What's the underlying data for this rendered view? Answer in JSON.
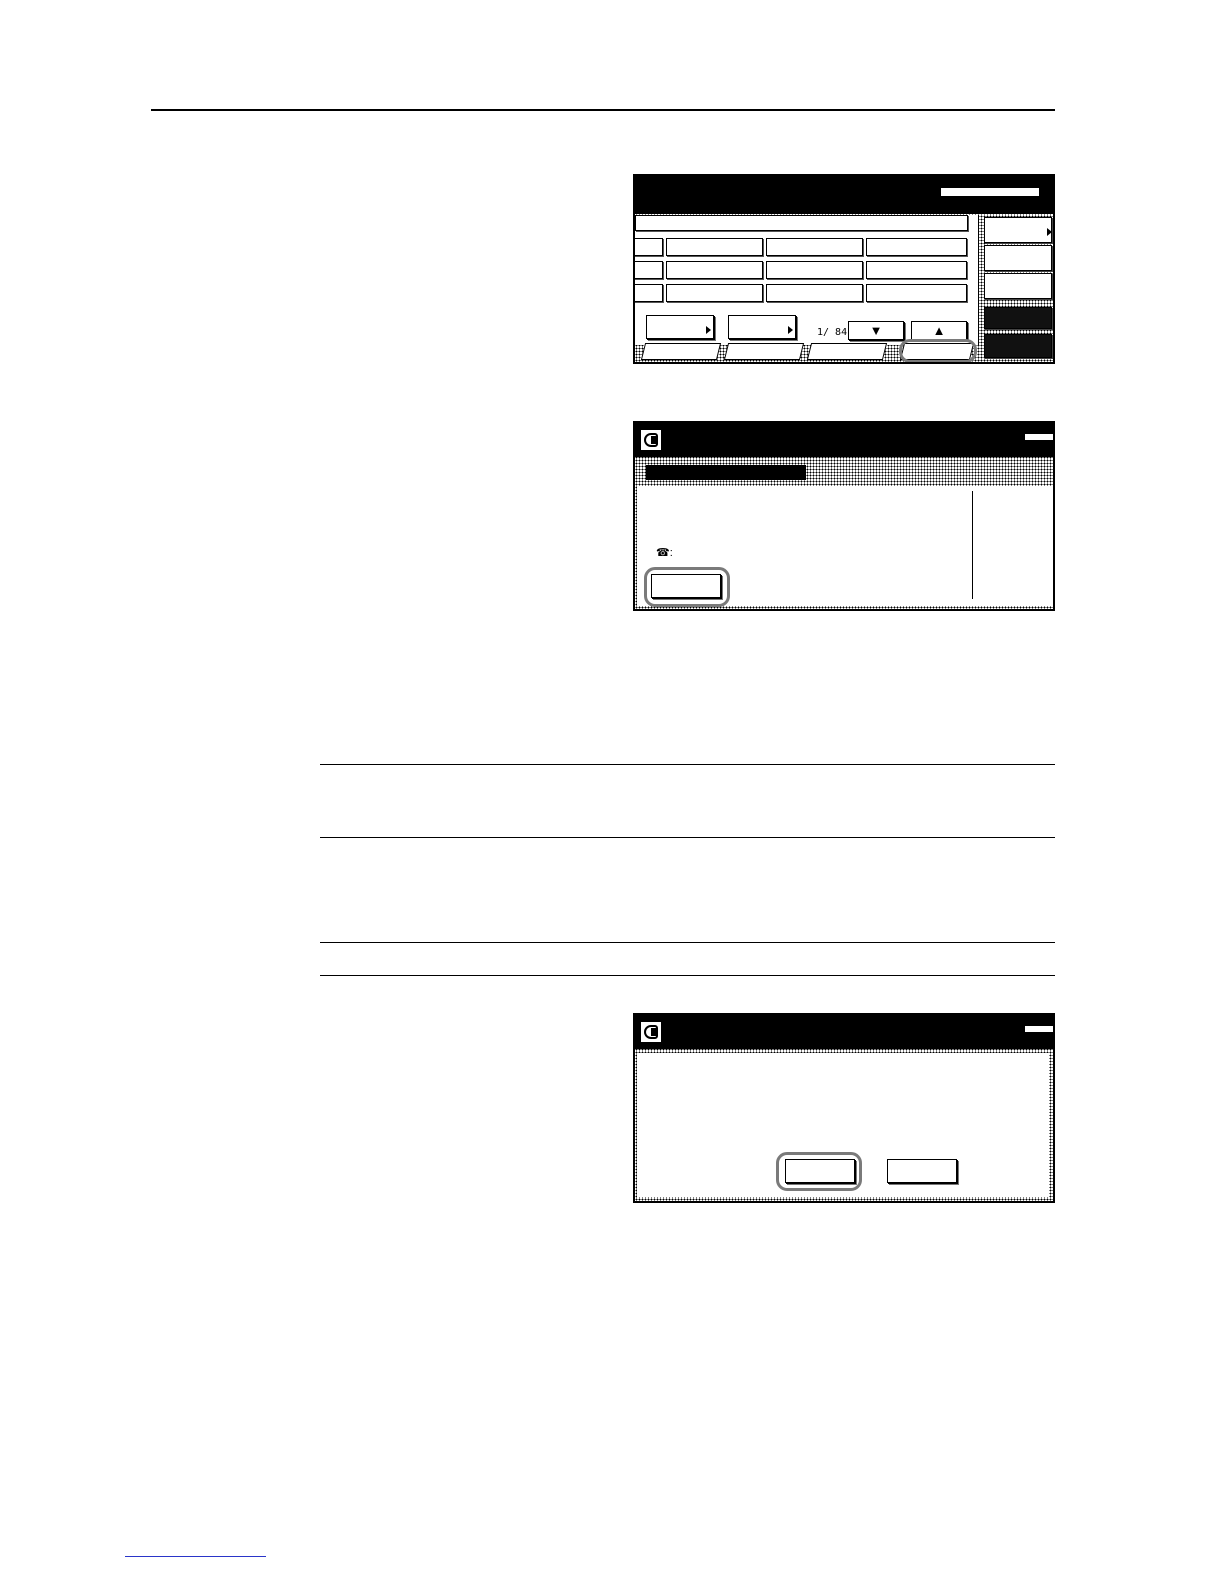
{
  "screen1": {
    "page_counter": "1/ 84",
    "arrow_down": "▼",
    "arrow_up": "▲"
  },
  "screen2": {
    "phone_label": "☎:"
  }
}
